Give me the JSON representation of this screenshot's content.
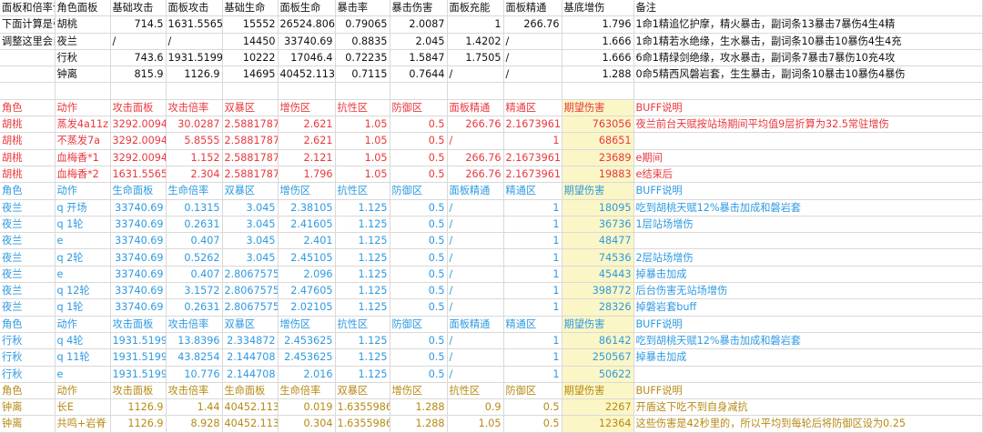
{
  "rows": [
    [
      "面板和倍率设定部分",
      "角色面板",
      "基础攻击",
      "面板攻击",
      "基础生命",
      "面板生命",
      "暴击率",
      "暴击伤害",
      "面板充能",
      "面板精通",
      "基底增伤",
      "备注"
    ],
    [
      "下面计算是引用这些",
      "胡桃",
      "714.5",
      "1631.5565",
      "15552",
      "26524.806",
      "0.79065",
      "2.0087",
      "1",
      "266.76",
      "1.796",
      "1命1精追忆护摩，精火暴击，副词条13暴击7暴伤4生4精"
    ],
    [
      "调整这里会自动同步",
      "夜兰",
      "/",
      "/",
      "14450",
      "33740.69",
      "0.8835",
      "2.045",
      "1.4202",
      "/",
      "1.666",
      "1命1精若水绝缘，生水暴击，副词条10暴击10暴伤4生4充"
    ],
    [
      "",
      "行秋",
      "743.6",
      "1931.5199",
      "10222",
      "17046.4",
      "0.72235",
      "1.5847",
      "1.7505",
      "/",
      "1.666",
      "6命1精绿剑绝缘，攻水暴击，副词条7暴击7暴伤10充4攻"
    ],
    [
      "",
      "钟离",
      "815.9",
      "1126.9",
      "14695",
      "40452.113",
      "0.7115",
      "0.7644",
      "/",
      "/",
      "1.288",
      "0命5精西风磐岩套，生生暴击，副词条10暴击10暴伤4暴伤"
    ],
    [
      "",
      "",
      "",
      "",
      "",
      "",
      "",
      "",
      "",
      "",
      "",
      ""
    ],
    [
      "角色",
      "动作",
      "攻击面板",
      "攻击倍率",
      "双暴区",
      "增伤区",
      "抗性区",
      "防御区",
      "面板精通",
      "精通区",
      "期望伤害",
      "BUFF说明"
    ],
    [
      "胡桃",
      "蒸发4a11z",
      "3292.0094",
      "30.0287",
      "2.5881787",
      "2.621",
      "1.05",
      "0.5",
      "266.76",
      "2.1673961",
      "763056",
      "夜兰前台天赋按站场期间平均值9层折算为32.5常驻增伤"
    ],
    [
      "胡桃",
      "不蒸发7a",
      "3292.0094",
      "5.8555",
      "2.5881787",
      "2.621",
      "1.05",
      "0.5",
      "/",
      "1",
      "68651",
      ""
    ],
    [
      "胡桃",
      "血梅香*1",
      "3292.0094",
      "1.152",
      "2.5881787",
      "2.121",
      "1.05",
      "0.5",
      "266.76",
      "2.1673961",
      "23689",
      "e期间"
    ],
    [
      "胡桃",
      "血梅香*2",
      "1631.5565",
      "2.304",
      "2.5881787",
      "1.796",
      "1.05",
      "0.5",
      "266.76",
      "2.1673961",
      "19883",
      "e结束后"
    ],
    [
      "角色",
      "动作",
      "生命面板",
      "生命倍率",
      "双暴区",
      "增伤区",
      "抗性区",
      "防御区",
      "面板精通",
      "精通区",
      "期望伤害",
      "BUFF说明"
    ],
    [
      "夜兰",
      "q 开场",
      "33740.69",
      "0.1315",
      "3.045",
      "2.38105",
      "1.125",
      "0.5",
      "/",
      "1",
      "18095",
      "吃到胡桃天赋12%暴击加成和磐岩套"
    ],
    [
      "夜兰",
      "q 1轮",
      "33740.69",
      "0.2631",
      "3.045",
      "2.41605",
      "1.125",
      "0.5",
      "/",
      "1",
      "36736",
      "1层站场增伤"
    ],
    [
      "夜兰",
      "e",
      "33740.69",
      "0.407",
      "3.045",
      "2.401",
      "1.125",
      "0.5",
      "/",
      "1",
      "48477",
      ""
    ],
    [
      "夜兰",
      "q 2轮",
      "33740.69",
      "0.5262",
      "3.045",
      "2.45105",
      "1.125",
      "0.5",
      "/",
      "1",
      "74536",
      "2层站场增伤"
    ],
    [
      "夜兰",
      "e",
      "33740.69",
      "0.407",
      "2.8067575",
      "2.096",
      "1.125",
      "0.5",
      "/",
      "1",
      "45443",
      "掉暴击加成"
    ],
    [
      "夜兰",
      "q 12轮",
      "33740.69",
      "3.1572",
      "2.8067575",
      "2.47605",
      "1.125",
      "0.5",
      "/",
      "1",
      "398772",
      "后台伤害无站场增伤"
    ],
    [
      "夜兰",
      "q 1轮",
      "33740.69",
      "0.2631",
      "2.8067575",
      "2.02105",
      "1.125",
      "0.5",
      "/",
      "1",
      "28326",
      "掉磐岩套buff"
    ],
    [
      "角色",
      "动作",
      "攻击面板",
      "攻击倍率",
      "双暴区",
      "增伤区",
      "抗性区",
      "防御区",
      "面板精通",
      "精通区",
      "期望伤害",
      "BUFF说明"
    ],
    [
      "行秋",
      "q 4轮",
      "1931.5199",
      "13.8396",
      "2.334872",
      "2.453625",
      "1.125",
      "0.5",
      "/",
      "1",
      "86142",
      "吃到胡桃天赋12%暴击加成和磐岩套"
    ],
    [
      "行秋",
      "q 11轮",
      "1931.5199",
      "43.8254",
      "2.144708",
      "2.453625",
      "1.125",
      "0.5",
      "/",
      "1",
      "250567",
      "掉暴击加成"
    ],
    [
      "行秋",
      "e",
      "1931.5199",
      "10.776",
      "2.144708",
      "2.016",
      "1.125",
      "0.5",
      "/",
      "1",
      "50622",
      ""
    ],
    [
      "角色",
      "动作",
      "攻击面板",
      "攻击倍率",
      "生命面板",
      "生命倍率",
      "双暴区",
      "增伤区",
      "抗性区",
      "防御区",
      "期望伤害",
      "BUFF说明"
    ],
    [
      "钟离",
      "长E",
      "1126.9",
      "1.44",
      "40452.113",
      "0.019",
      "1.6355986",
      "1.288",
      "0.9",
      "0.5",
      "2267",
      "开盾这下吃不到自身减抗"
    ],
    [
      "钟离",
      "共鸣+岩脊",
      "1126.9",
      "8.928",
      "40452.113",
      "0.304",
      "1.6355986",
      "1.288",
      "1.05",
      "0.5",
      "12364",
      "这些伤害是42秒里的，所以平均到每轮后将防御区设为0.25"
    ]
  ]
}
